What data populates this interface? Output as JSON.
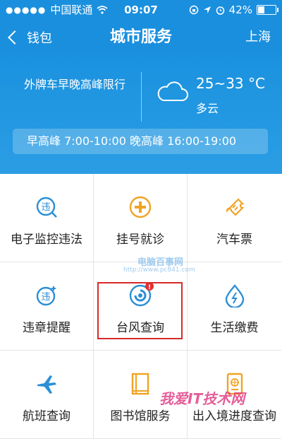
{
  "status_bar": {
    "carrier": "中国联通",
    "time": "09:07",
    "battery": "42%",
    "battery_level": 0.42
  },
  "nav": {
    "back_label": "钱包",
    "title": "城市服务",
    "city": "上海"
  },
  "info": {
    "restriction": "外牌车早晚高峰限行",
    "temperature": "25~33 °C",
    "weather": "多云",
    "peak_hours": "早高峰 7:00-10:00 晚高峰 16:00-19:00"
  },
  "services": [
    {
      "label": "电子监控违法",
      "icon": "traffic-violation-icon"
    },
    {
      "label": "挂号就诊",
      "icon": "medical-cross-icon"
    },
    {
      "label": "汽车票",
      "icon": "bus-ticket-icon"
    },
    {
      "label": "违章提醒",
      "icon": "violation-reminder-icon"
    },
    {
      "label": "台风查询",
      "icon": "typhoon-icon",
      "badge": "!"
    },
    {
      "label": "生活缴费",
      "icon": "water-drop-icon"
    },
    {
      "label": "航班查询",
      "icon": "airplane-icon"
    },
    {
      "label": "图书馆服务",
      "icon": "book-icon"
    },
    {
      "label": "出入境进度查询",
      "icon": "passport-icon"
    }
  ],
  "watermarks": {
    "top_name": "电脑百事网",
    "top_url": "http://www.pc841.com",
    "bottom": "我爱IT技术网"
  },
  "colors": {
    "primary_blue": "#1a8fde",
    "icon_blue": "#2b8fd6",
    "icon_orange": "#f0a323",
    "highlight_red": "#d72a2a"
  }
}
